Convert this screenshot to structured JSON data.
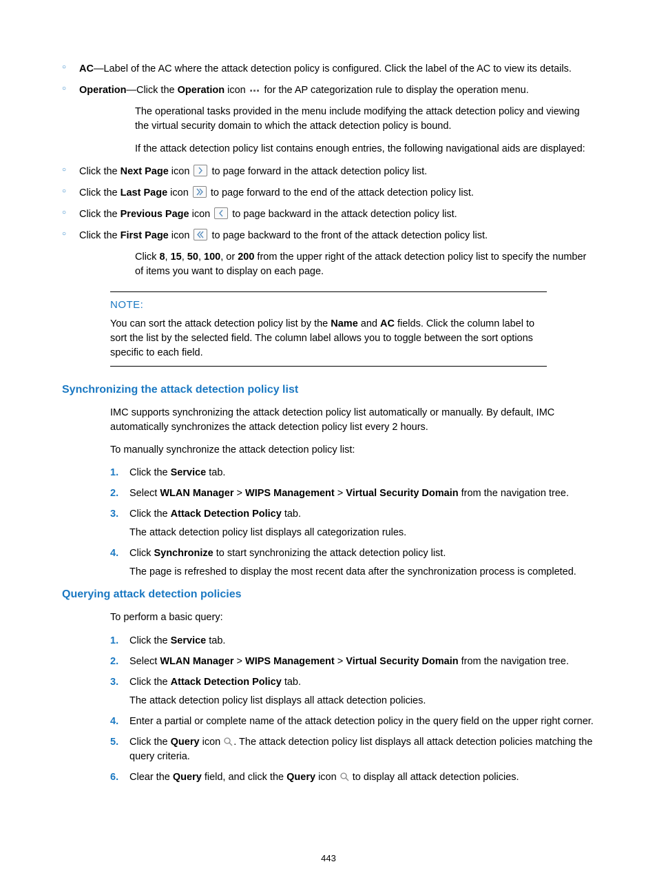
{
  "page_number": "443",
  "bullets_top": [
    {
      "prefix": "AC",
      "text": "—Label of the AC where the attack detection policy is configured. Click the label of the AC to view its details."
    },
    {
      "prefix": "Operation",
      "text_before": "—Click the ",
      "bold1": "Operation",
      "text_mid": " icon ",
      "icon": "dots",
      "text_after": " for the AP categorization rule to display the operation menu."
    }
  ],
  "para1": "The operational tasks provided in the menu include modifying the attack detection policy and viewing the virtual security domain to which the attack detection policy is bound.",
  "para2": "If the attack detection policy list contains enough entries, the following navigational aids are displayed:",
  "nav_bullets": [
    {
      "pre": "Click the ",
      "bold": "Next Page",
      "mid": " icon ",
      "icon": "next",
      "after": " to page forward in the attack detection policy list."
    },
    {
      "pre": "Click the ",
      "bold": "Last Page",
      "mid": " icon ",
      "icon": "last",
      "after": " to page forward to the end of the attack detection policy list."
    },
    {
      "pre": "Click the ",
      "bold": "Previous Page",
      "mid": " icon ",
      "icon": "prev",
      "after": " to page backward in the attack detection policy list."
    },
    {
      "pre": "Click the ",
      "bold": "First Page",
      "mid": " icon ",
      "icon": "first",
      "after": " to page backward to the front of the attack detection policy list."
    }
  ],
  "para3_pre": "Click ",
  "para3_nums": [
    "8",
    "15",
    "50",
    "100",
    "200"
  ],
  "para3_join": ", ",
  "para3_or": ", or ",
  "para3_after": " from the upper right of the attack detection policy list to specify the number of items you want to display on each page.",
  "note_title": "NOTE:",
  "note_body_pre": "You can sort the attack detection policy list by the ",
  "note_body_b1": "Name",
  "note_body_mid": " and ",
  "note_body_b2": "AC",
  "note_body_after": " fields. Click the column label to sort the list by the selected field. The column label allows you to toggle between the sort options specific to each field.",
  "sync_heading": "Synchronizing the attack detection policy list",
  "sync_intro": "IMC supports synchronizing the attack detection policy list automatically or manually. By default, IMC automatically synchronizes the attack detection policy list every 2 hours.",
  "sync_intro2": "To manually synchronize the attack detection policy list:",
  "sync_steps": [
    {
      "n": "1.",
      "parts": [
        {
          "t": "Click the "
        },
        {
          "b": "Service"
        },
        {
          "t": " tab."
        }
      ]
    },
    {
      "n": "2.",
      "parts": [
        {
          "t": "Select "
        },
        {
          "b": "WLAN Manager"
        },
        {
          "t": " > "
        },
        {
          "b": "WIPS Management"
        },
        {
          "t": " > "
        },
        {
          "b": "Virtual Security Domain"
        },
        {
          "t": " from the navigation tree."
        }
      ]
    },
    {
      "n": "3.",
      "parts": [
        {
          "t": "Click the "
        },
        {
          "b": "Attack Detection Policy"
        },
        {
          "t": " tab."
        }
      ],
      "sub": "The attack detection policy list displays all categorization rules."
    },
    {
      "n": "4.",
      "parts": [
        {
          "t": "Click "
        },
        {
          "b": "Synchronize"
        },
        {
          "t": " to start synchronizing the attack detection policy list."
        }
      ],
      "sub": "The page is refreshed to display the most recent data after the synchronization process is completed."
    }
  ],
  "query_heading": "Querying attack detection policies",
  "query_intro": "To perform a basic query:",
  "query_steps": [
    {
      "n": "1.",
      "parts": [
        {
          "t": "Click the "
        },
        {
          "b": "Service"
        },
        {
          "t": " tab."
        }
      ]
    },
    {
      "n": "2.",
      "parts": [
        {
          "t": "Select "
        },
        {
          "b": "WLAN Manager"
        },
        {
          "t": " > "
        },
        {
          "b": "WIPS Management"
        },
        {
          "t": " > "
        },
        {
          "b": "Virtual Security Domain"
        },
        {
          "t": " from the navigation tree."
        }
      ]
    },
    {
      "n": "3.",
      "parts": [
        {
          "t": "Click the "
        },
        {
          "b": "Attack Detection Policy"
        },
        {
          "t": " tab."
        }
      ],
      "sub": "The attack detection policy list displays all attack detection policies."
    },
    {
      "n": "4.",
      "parts": [
        {
          "t": "Enter a partial or complete name of the attack detection policy in the query field on the upper right corner."
        }
      ]
    },
    {
      "n": "5.",
      "parts": [
        {
          "t": "Click the "
        },
        {
          "b": "Query"
        },
        {
          "t": " icon "
        },
        {
          "icon": "search"
        },
        {
          "t": ". The attack detection policy list displays all attack detection policies matching the query criteria."
        }
      ]
    },
    {
      "n": "6.",
      "parts": [
        {
          "t": "Clear the "
        },
        {
          "b": "Query"
        },
        {
          "t": " field, and click the "
        },
        {
          "b": "Query"
        },
        {
          "t": " icon "
        },
        {
          "icon": "search"
        },
        {
          "t": " to display all attack detection policies."
        }
      ]
    }
  ]
}
